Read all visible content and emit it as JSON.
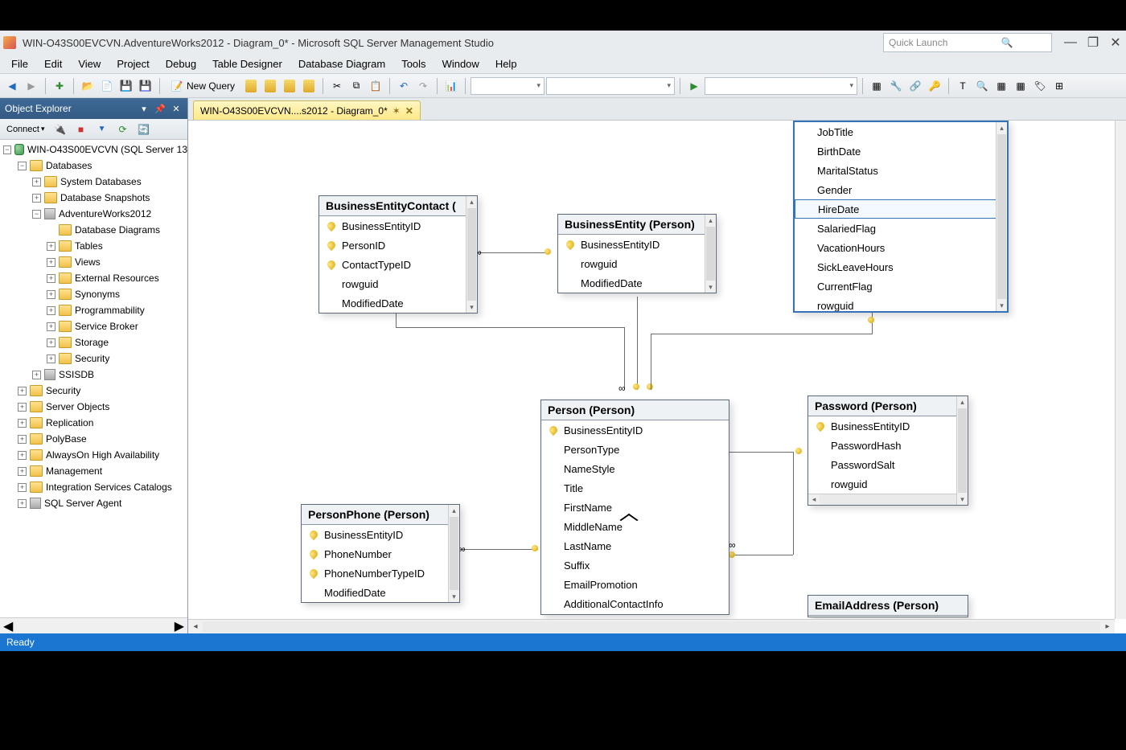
{
  "window": {
    "title": "WIN-O43S00EVCVN.AdventureWorks2012 - Diagram_0* - Microsoft SQL Server Management Studio",
    "quicklaunch_placeholder": "Quick Launch"
  },
  "menu": [
    "File",
    "Edit",
    "View",
    "Project",
    "Debug",
    "Table Designer",
    "Database Diagram",
    "Tools",
    "Window",
    "Help"
  ],
  "toolbar": {
    "new_query": "New Query"
  },
  "sidebar": {
    "title": "Object Explorer",
    "connect": "Connect",
    "root": "WIN-O43S00EVCVN (SQL Server 13",
    "nodes": {
      "databases": "Databases",
      "system_databases": "System Databases",
      "db_snapshots": "Database Snapshots",
      "adventure": "AdventureWorks2012",
      "db_diagrams": "Database Diagrams",
      "tables": "Tables",
      "views": "Views",
      "ext_resources": "External Resources",
      "synonyms": "Synonyms",
      "programmability": "Programmability",
      "service_broker": "Service Broker",
      "storage": "Storage",
      "security_db": "Security",
      "ssisdb": "SSISDB",
      "security": "Security",
      "server_objects": "Server Objects",
      "replication": "Replication",
      "polybase": "PolyBase",
      "always_on": "AlwaysOn High Availability",
      "management": "Management",
      "isc": "Integration Services Catalogs",
      "agent": "SQL Server Agent"
    }
  },
  "tab": {
    "label": "WIN-O43S00EVCVN....s2012 - Diagram_0*",
    "dirty": "✶"
  },
  "tables": {
    "bec": {
      "title": "BusinessEntityContact (",
      "cols": [
        {
          "k": true,
          "n": "BusinessEntityID"
        },
        {
          "k": true,
          "n": "PersonID"
        },
        {
          "k": true,
          "n": "ContactTypeID"
        },
        {
          "k": false,
          "n": "rowguid"
        },
        {
          "k": false,
          "n": "ModifiedDate"
        }
      ]
    },
    "be": {
      "title": "BusinessEntity (Person)",
      "cols": [
        {
          "k": true,
          "n": "BusinessEntityID"
        },
        {
          "k": false,
          "n": "rowguid"
        },
        {
          "k": false,
          "n": "ModifiedDate"
        }
      ]
    },
    "emp": {
      "cols": [
        {
          "n": "JobTitle"
        },
        {
          "n": "BirthDate"
        },
        {
          "n": "MaritalStatus"
        },
        {
          "n": "Gender"
        },
        {
          "n": "HireDate",
          "sel": true
        },
        {
          "n": "SalariedFlag"
        },
        {
          "n": "VacationHours"
        },
        {
          "n": "SickLeaveHours"
        },
        {
          "n": "CurrentFlag"
        },
        {
          "n": "rowguid"
        }
      ]
    },
    "person": {
      "title": "Person (Person)",
      "cols": [
        {
          "k": true,
          "n": "BusinessEntityID"
        },
        {
          "k": false,
          "n": "PersonType"
        },
        {
          "k": false,
          "n": "NameStyle"
        },
        {
          "k": false,
          "n": "Title"
        },
        {
          "k": false,
          "n": "FirstName"
        },
        {
          "k": false,
          "n": "MiddleName"
        },
        {
          "k": false,
          "n": "LastName"
        },
        {
          "k": false,
          "n": "Suffix"
        },
        {
          "k": false,
          "n": "EmailPromotion"
        },
        {
          "k": false,
          "n": "AdditionalContactInfo"
        }
      ]
    },
    "phone": {
      "title": "PersonPhone (Person)",
      "cols": [
        {
          "k": true,
          "n": "BusinessEntityID"
        },
        {
          "k": true,
          "n": "PhoneNumber"
        },
        {
          "k": true,
          "n": "PhoneNumberTypeID"
        },
        {
          "k": false,
          "n": "ModifiedDate"
        }
      ]
    },
    "pwd": {
      "title": "Password (Person)",
      "cols": [
        {
          "k": true,
          "n": "BusinessEntityID"
        },
        {
          "k": false,
          "n": "PasswordHash"
        },
        {
          "k": false,
          "n": "PasswordSalt"
        },
        {
          "k": false,
          "n": "rowguid"
        }
      ]
    },
    "email": {
      "title": "EmailAddress (Person)"
    }
  },
  "status": {
    "text": "Ready"
  }
}
